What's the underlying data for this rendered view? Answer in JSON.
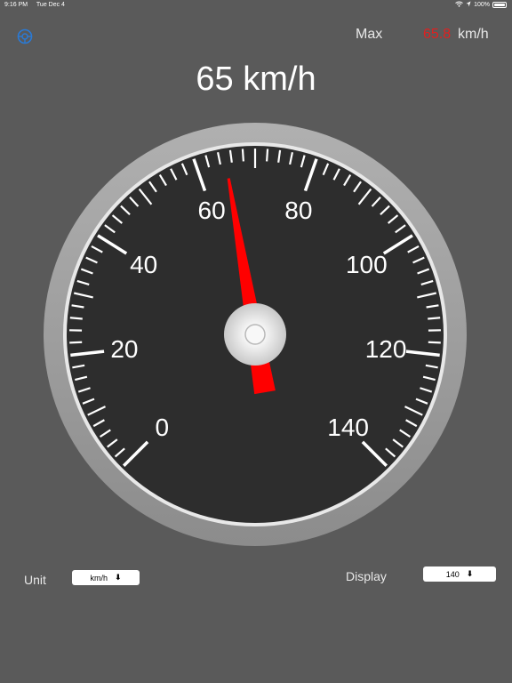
{
  "status_bar": {
    "time": "9:16 PM",
    "date": "Tue Dec 4",
    "battery": "100%"
  },
  "header": {
    "settings_icon": "settings-gear-icon",
    "max_label": "Max",
    "max_value": "65.8",
    "max_unit": "km/h",
    "max_color": "#e02020"
  },
  "speed": {
    "value": 65,
    "unit": "km/h",
    "readout": "65 km/h"
  },
  "gauge": {
    "min": 0,
    "max": 140,
    "major_labels": [
      "0",
      "20",
      "40",
      "60",
      "80",
      "100",
      "120",
      "140"
    ],
    "needle_value": 65,
    "needle_color": "#ff0000",
    "dial_color": "#2d2d2d",
    "bezel_color": "#9a9a9a"
  },
  "controls": {
    "unit_label": "Unit",
    "unit_value": "km/h",
    "display_label": "Display",
    "display_value": "140"
  }
}
